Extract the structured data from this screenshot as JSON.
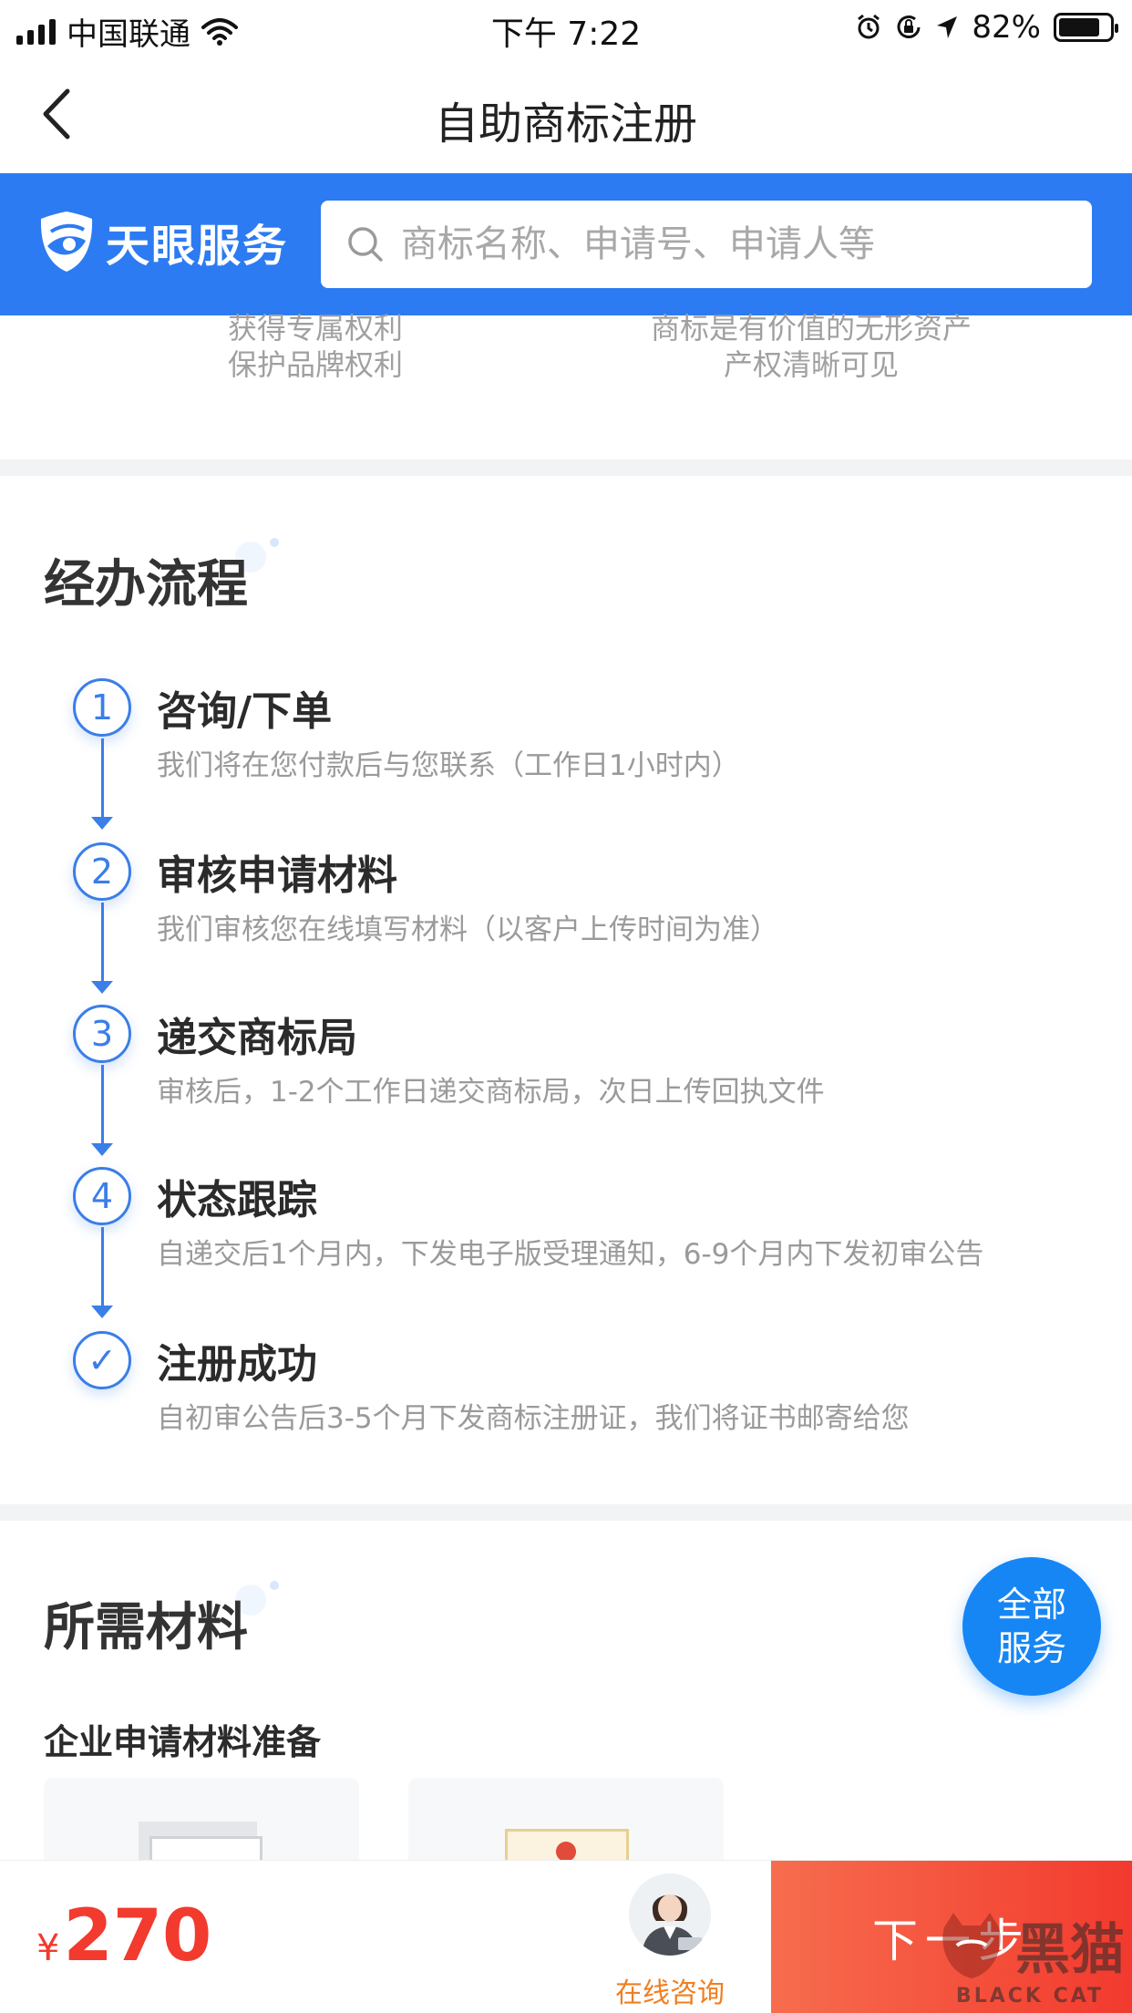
{
  "status_bar": {
    "carrier": "中国联通",
    "time": "下午 7:22",
    "battery_percent": "82%",
    "battery_level": 0.82,
    "icons": [
      "signal-icon",
      "wifi-icon",
      "alarm-icon",
      "rotation-lock-icon",
      "location-icon",
      "battery-icon"
    ]
  },
  "nav": {
    "title": "自助商标注册",
    "back_icon": "chevron-left-icon"
  },
  "header": {
    "brand": "天眼服务",
    "search_placeholder": "商标名称、申请号、申请人等",
    "accent": "#2c7bf2"
  },
  "benefits": [
    {
      "line1": "获得专属权利",
      "line2": "保护品牌权利"
    },
    {
      "line1": "商标是有价值的无形资产",
      "line2": "产权清晰可见"
    }
  ],
  "process": {
    "title": "经办流程",
    "steps": [
      {
        "marker": "1",
        "title": "咨询/下单",
        "desc": "我们将在您付款后与您联系（工作日1小时内）"
      },
      {
        "marker": "2",
        "title": "审核申请材料",
        "desc": "我们审核您在线填写材料（以客户上传时间为准）"
      },
      {
        "marker": "3",
        "title": "递交商标局",
        "desc": "审核后，1-2个工作日递交商标局，次日上传回执文件"
      },
      {
        "marker": "4",
        "title": "状态跟踪",
        "desc": "自递交后1个月内，下发电子版受理通知，6-9个月内下发初审公告"
      },
      {
        "marker": "✓",
        "title": "注册成功",
        "desc": "自初审公告后3-5个月下发商标注册证，我们将证书邮寄给您"
      }
    ]
  },
  "materials": {
    "title": "所需材料",
    "subtitle": "企业申请材料准备"
  },
  "float_button": {
    "line1": "全部",
    "line2": "服务"
  },
  "bottom_bar": {
    "currency": "¥",
    "price": "270",
    "consult_label": "在线咨询",
    "next_label": "下一步",
    "price_color": "#f23a2e"
  },
  "watermark": {
    "cn": "黑猫",
    "en": "BLACK CAT"
  }
}
